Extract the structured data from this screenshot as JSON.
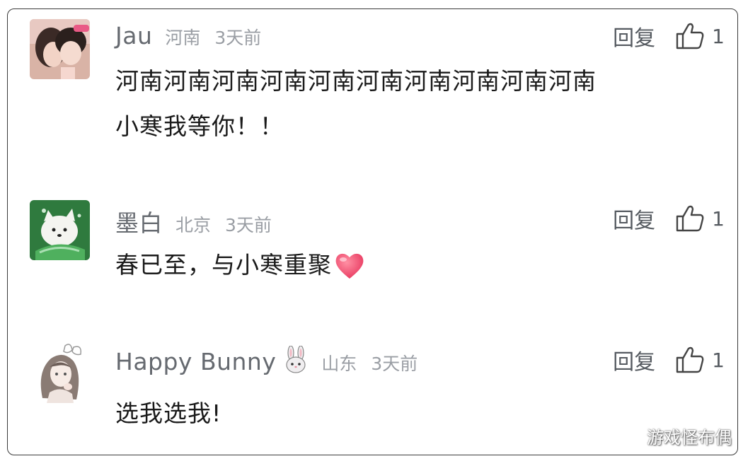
{
  "comments": [
    {
      "username": "Jau",
      "region": "河南",
      "time": "3天前",
      "reply_label": "回复",
      "like_count": "1",
      "avatar_icon": "couple-photo-avatar",
      "lines": [
        "河南河南河南河南河南河南河南河南河南河南",
        "小寒我等你！！"
      ]
    },
    {
      "username": "墨白",
      "region": "北京",
      "time": "3天前",
      "reply_label": "回复",
      "like_count": "1",
      "avatar_icon": "white-dog-avatar",
      "lines": [
        "春已至，与小寒重聚"
      ],
      "trailing_icon": "heart-emoji"
    },
    {
      "username": "Happy Bunny",
      "username_emoji": "🐰",
      "region": "山东",
      "time": "3天前",
      "reply_label": "回复",
      "like_count": "1",
      "avatar_icon": "anime-girl-avatar",
      "lines": [
        "选我选我!"
      ]
    }
  ],
  "watermark": "游戏怪布偶",
  "colors": {
    "text": "#1a1a1a",
    "meta": "#9a9ea4",
    "name": "#666a70",
    "heart": "#f0506e"
  }
}
